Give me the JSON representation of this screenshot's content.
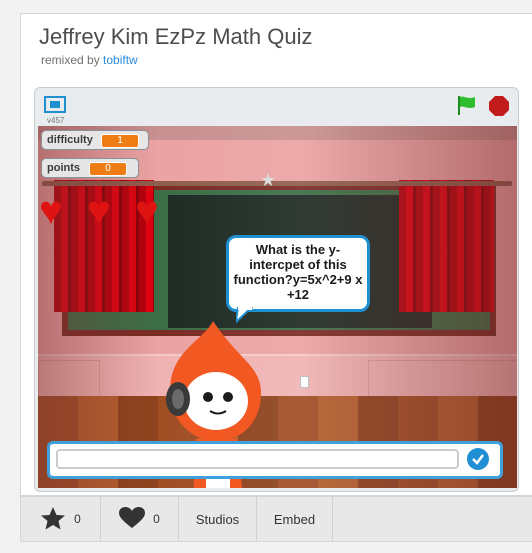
{
  "project": {
    "title": "Jeffrey Kim EzPz Math Quiz",
    "remixed_prefix": "remixed by",
    "remixed_user": "tobiftw"
  },
  "player": {
    "version": "v457",
    "icons": {
      "fullscreen": "fullscreen-icon",
      "green_flag": "green-flag-icon",
      "stop": "stop-sign-icon"
    },
    "colors": {
      "flag": "#2ebd2e",
      "stop": "#c21b1b",
      "accent": "#1e8fcf",
      "monitor_value": "#ee7d16"
    }
  },
  "stage": {
    "monitors": [
      {
        "label": "difficulty",
        "value": "1"
      },
      {
        "label": "points",
        "value": "0"
      }
    ],
    "lives": 3,
    "question": "What is the y-intercpet of this function?y=5x^2+9 x +12",
    "answer": {
      "value": "",
      "placeholder": ""
    }
  },
  "footer": {
    "favorite_count": "0",
    "love_count": "0",
    "studios_label": "Studios",
    "embed_label": "Embed"
  }
}
